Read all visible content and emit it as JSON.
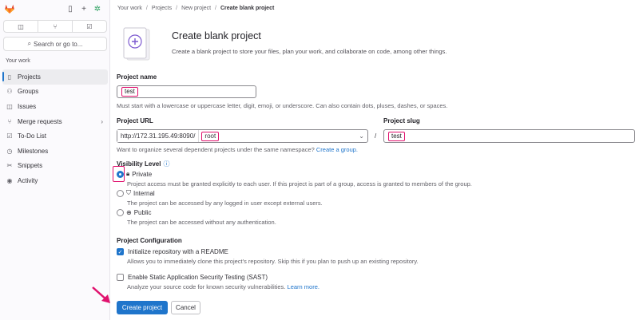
{
  "sidebar": {
    "search_label": "Search or go to...",
    "section_title": "Your work",
    "items": [
      {
        "label": "Projects",
        "icon": "project-icon",
        "active": true
      },
      {
        "label": "Groups",
        "icon": "group-icon"
      },
      {
        "label": "Issues",
        "icon": "issues-icon"
      },
      {
        "label": "Merge requests",
        "icon": "merge-request-icon",
        "chevron": true
      },
      {
        "label": "To-Do List",
        "icon": "todo-icon"
      },
      {
        "label": "Milestones",
        "icon": "milestone-icon"
      },
      {
        "label": "Snippets",
        "icon": "snippet-icon"
      },
      {
        "label": "Activity",
        "icon": "activity-icon"
      }
    ]
  },
  "breadcrumb": [
    "Your work",
    "Projects",
    "New project",
    "Create blank project"
  ],
  "hero": {
    "title": "Create blank project",
    "description": "Create a blank project to store your files, plan your work, and collaborate on code, among other things."
  },
  "form": {
    "project_name_label": "Project name",
    "project_name_value": "test",
    "project_name_help": "Must start with a lowercase or uppercase letter, digit, emoji, or underscore. Can also contain dots, pluses, dashes, or spaces.",
    "project_url_label": "Project URL",
    "url_prefix": "http://172.31.195.49:8090/",
    "namespace_value": "root",
    "slash": "/",
    "project_slug_label": "Project slug",
    "project_slug_value": "test",
    "namespace_help": "Want to organize several dependent projects under the same namespace?",
    "create_group_link": "Create a group.",
    "visibility_label": "Visibility Level",
    "visibility": [
      {
        "label": "Private",
        "desc": "Project access must be granted explicitly to each user. If this project is part of a group, access is granted to members of the group.",
        "checked": true,
        "icon": "lock-icon"
      },
      {
        "label": "Internal",
        "desc": "The project can be accessed by any logged in user except external users.",
        "checked": false,
        "icon": "shield-icon"
      },
      {
        "label": "Public",
        "desc": "The project can be accessed without any authentication.",
        "checked": false,
        "icon": "globe-icon"
      }
    ],
    "config_label": "Project Configuration",
    "readme_label": "Initialize repository with a README",
    "readme_desc": "Allows you to immediately clone this project's repository. Skip this if you plan to push up an existing repository.",
    "readme_checked": true,
    "sast_label": "Enable Static Application Security Testing (SAST)",
    "sast_desc": "Analyze your source code for known security vulnerabilities.",
    "sast_link": "Learn more.",
    "sast_checked": false,
    "create_button": "Create project",
    "cancel_button": "Cancel"
  },
  "colors": {
    "accent": "#1f75cb",
    "highlight": "#e0116e",
    "logo": "#e24329"
  }
}
